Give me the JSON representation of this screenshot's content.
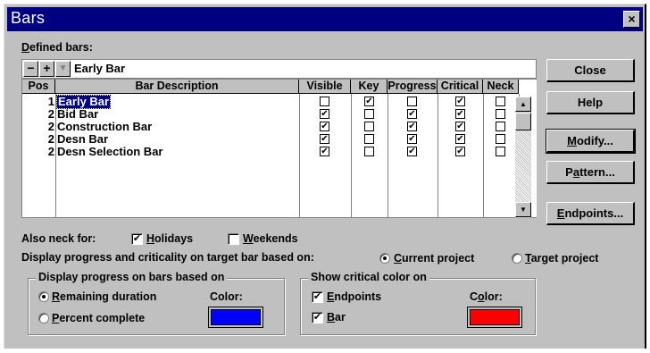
{
  "window": {
    "title": "Bars",
    "close_glyph": "×"
  },
  "defined_bars": {
    "label_prefix": "D",
    "label_rest": "efined bars:",
    "toolbar": {
      "remove": "−",
      "add": "+",
      "dropdown": "▼"
    },
    "edit_value": "Early Bar",
    "columns": [
      "Pos",
      "Bar Description",
      "Visible",
      "Key",
      "Progress",
      "Critical",
      "Neck"
    ],
    "rows": [
      {
        "pos": "1",
        "description": "Early Bar",
        "visible": false,
        "key": true,
        "progress": false,
        "critical": true,
        "neck": false,
        "selected": true
      },
      {
        "pos": "2",
        "description": "Bid Bar",
        "visible": true,
        "key": false,
        "progress": true,
        "critical": true,
        "neck": false
      },
      {
        "pos": "2",
        "description": "Construction Bar",
        "visible": true,
        "key": false,
        "progress": true,
        "critical": true,
        "neck": false
      },
      {
        "pos": "2",
        "description": "Desn Bar",
        "visible": true,
        "key": false,
        "progress": true,
        "critical": true,
        "neck": false
      },
      {
        "pos": "2",
        "description": "Desn Selection Bar",
        "visible": true,
        "key": false,
        "progress": true,
        "critical": true,
        "neck": false
      }
    ],
    "check_glyph": "☑"
  },
  "buttons": {
    "close": "Close",
    "help": "Help",
    "modify_u": "M",
    "modify_rest": "odify...",
    "pattern_pre": "P",
    "pattern_u": "a",
    "pattern_rest": "ttern...",
    "endpoints_u": "E",
    "endpoints_rest": "ndpoints..."
  },
  "neck": {
    "label": "Also neck for:",
    "holidays_u": "H",
    "holidays_rest": "olidays",
    "holidays_checked": true,
    "weekends_u": "W",
    "weekends_rest": "eekends",
    "weekends_checked": false
  },
  "display_based": {
    "label": "Display progress and criticality on target bar based on:",
    "current_u": "C",
    "current_rest": "urrent project",
    "current_selected": true,
    "target_u": "T",
    "target_rest": "arget project",
    "target_selected": false
  },
  "progress_group": {
    "title": "Display progress on bars based on",
    "remaining_u": "R",
    "remaining_rest": "emaining duration",
    "remaining_selected": true,
    "percent_u": "P",
    "percent_rest": "ercent complete",
    "percent_selected": false,
    "color_label": "Color:",
    "color": "#0000ff"
  },
  "critical_group": {
    "title": "Show critical color on",
    "endpoints_u": "E",
    "endpoints_rest": "ndpoints",
    "endpoints_checked": true,
    "bar_u": "B",
    "bar_rest": "ar",
    "bar_checked": true,
    "color_label_pre": "C",
    "color_label_u": "o",
    "color_label_rest": "lor:",
    "color": "#ff0000"
  }
}
